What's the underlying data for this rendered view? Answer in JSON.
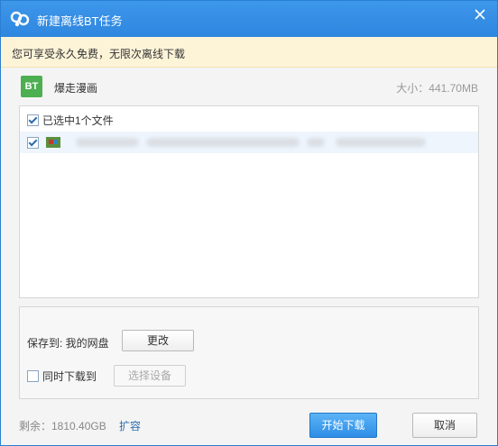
{
  "window": {
    "title": "新建离线BT任务"
  },
  "banner": {
    "text": "您可享受永久免费，无限次离线下载"
  },
  "task": {
    "badge": "BT",
    "name": "爆走漫画",
    "size": "大小：441.70MB"
  },
  "file_list": {
    "header_label": "已选中1个文件",
    "header_checked": true,
    "items": [
      {
        "checked": true,
        "name_blurred": true
      }
    ]
  },
  "save": {
    "label": "保存到: 我的网盘",
    "change_button": "更改",
    "simultaneous_label": "同时下载到",
    "simultaneous_checked": false,
    "device_button": "选择设备"
  },
  "footer": {
    "remaining": "剩余：1810.40GB",
    "expand_link": "扩容",
    "start_button": "开始下载",
    "cancel_button": "取消"
  },
  "colors": {
    "accent": "#2f86df",
    "bt_badge": "#4caf50",
    "banner_bg": "#fdf4d8"
  },
  "icons": [
    "cloud-logo-icon",
    "close-icon",
    "bt-file-icon",
    "file-type-icon"
  ]
}
